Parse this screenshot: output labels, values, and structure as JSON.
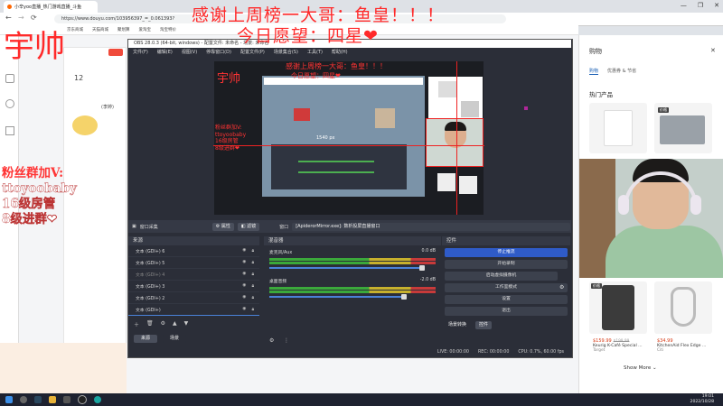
{
  "browser": {
    "tab_title": "小辛yoo直播_热门游戏直播_斗鱼",
    "url": "https://www.douyu.com/103956397_=_0.061393?",
    "favorites": [
      "京东商城",
      "天猫商城",
      "聚划算",
      "爱淘宝",
      "淘宝特价"
    ],
    "window_controls": [
      "—",
      "❐",
      "✕"
    ]
  },
  "douyu": {
    "follower_count": "12",
    "mascot_text": "(李婷)"
  },
  "overlays": {
    "line1": "感谢上周榜一大哥：鱼皇！！！",
    "line2": "今日愿望：四星❤",
    "corner": "宇帅",
    "fans_title": "粉丝群加V:",
    "fans_wechat": "ttoyoobaby",
    "fans_level16": "16级房管",
    "fans_level8": "8级进群❤"
  },
  "obs": {
    "title": "OBS 28.0.3 (64-bit, windows) - 配置文件: 未命名 - 场景: 未命名",
    "menu": [
      "文件(F)",
      "编辑(E)",
      "视图(V)",
      "停靠窗口(D)",
      "配置文件(P)",
      "场景集合(S)",
      "工具(T)",
      "帮助(H)"
    ],
    "preview_dim": "1540 px",
    "source_bar": {
      "source_label": "窗口采集",
      "properties": "属性",
      "filters": "滤镜",
      "window_label": "窗口",
      "window_value": "[ApiderorMirror.exe]: 数析投屏直播窗口"
    },
    "scenes_panel": {
      "title": "来源",
      "sources": [
        "文本 (GDI+) 6",
        "文本 (GDI+) 5",
        "文本 (GDI+) 4",
        "文本 (GDI+) 3",
        "文本 (GDI+) 2",
        "文本 (GDI+)"
      ],
      "bottom_tabs": [
        "来源",
        "场景"
      ]
    },
    "mixer_panel": {
      "title": "混音器",
      "tracks": [
        {
          "name": "麦克风/Aux",
          "db": "0.0 dB",
          "level": 0.92
        },
        {
          "name": "桌面音频",
          "db": "-2.0 dB",
          "level": 0.86
        }
      ]
    },
    "controls_panel": {
      "title": "控件",
      "buttons": [
        "停止推流",
        "开始录制",
        "启动虚拟摄像机",
        "工作室模式",
        "设置",
        "退出"
      ],
      "bottom_tabs": [
        "场景转换",
        "控件"
      ]
    },
    "status": {
      "live": "LIVE: 00:00:00",
      "rec": "REC: 00:00:00",
      "cpu": "CPU: 0.7%, 60.00 fps"
    }
  },
  "shop": {
    "title": "购物",
    "tabs": [
      "购物",
      "优惠券 & 节省"
    ],
    "hot_label": "热门产品",
    "products": [
      {
        "price": "$159.99",
        "was": "$199.99",
        "name": "Keurig K-Café Special ...",
        "store": "Target"
      },
      {
        "price": "$34.99",
        "was": "",
        "name": "KitchenAid Flex Edge ...",
        "store": "Citi"
      }
    ],
    "badge": "价格",
    "show_more": "Show More"
  },
  "taskbar": {
    "time": "19:01",
    "date": "2022/10/28"
  }
}
